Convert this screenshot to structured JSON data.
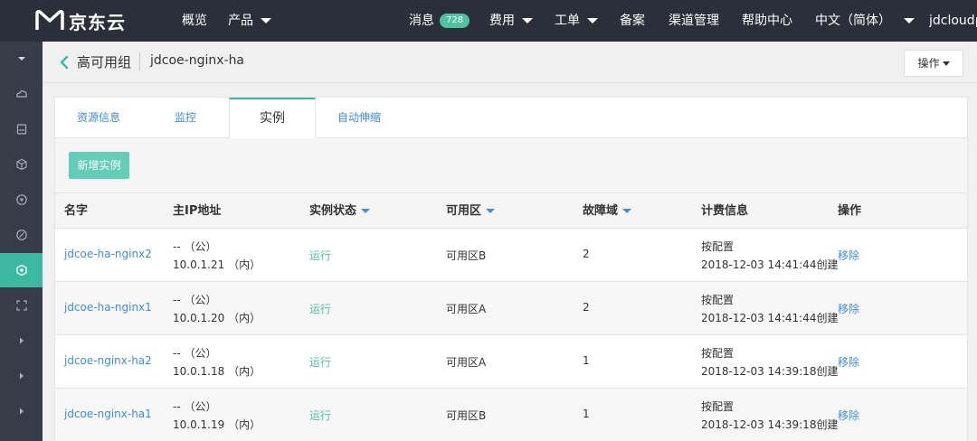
{
  "topbar": {
    "brand": "京东云",
    "nav": [
      {
        "label": "概览",
        "dropdown": false
      },
      {
        "label": "产品",
        "dropdown": true
      }
    ],
    "right": {
      "messages_label": "消息",
      "messages_count": "728",
      "fees_label": "费用",
      "tickets_label": "工单",
      "filing_label": "备案",
      "channel_label": "渠道管理",
      "help_label": "帮助中心",
      "language_label": "中文（简体）",
      "user_label": "jdcloudpr"
    }
  },
  "sidebar": {
    "icons": [
      "chevron-down-icon",
      "cloud-host-icon",
      "database-icon",
      "cube-icon",
      "network-icon",
      "security-icon",
      "ha-group-icon",
      "expand-icon",
      "chevron-right-icon",
      "chevron-right-icon",
      "chevron-right-icon"
    ],
    "active_index": 6
  },
  "breadcrumb": {
    "title": "高可用组",
    "subtitle": "jdcoe-nginx-ha",
    "operate_label": "操作"
  },
  "tabs": [
    {
      "label": "资源信息",
      "active": false
    },
    {
      "label": "监控",
      "active": false
    },
    {
      "label": "实例",
      "active": true
    },
    {
      "label": "自动伸缩",
      "active": false
    }
  ],
  "toolbar": {
    "add_instance_label": "新增实例"
  },
  "table": {
    "headers": {
      "name": "名字",
      "ip": "主IP地址",
      "status": "实例状态",
      "az": "可用区",
      "fault_domain": "故障域",
      "billing": "计费信息",
      "action": "操作"
    },
    "rows": [
      {
        "name": "jdcoe-ha-nginx2",
        "public_ip": "-- （公）",
        "private_ip": "10.0.1.21 （内）",
        "status": "运行",
        "az": "可用区B",
        "fault_domain": "2",
        "billing_type": "按配置",
        "created": "2018-12-03 14:41:44创建",
        "action": "移除"
      },
      {
        "name": "jdcoe-ha-nginx1",
        "public_ip": "-- （公）",
        "private_ip": "10.0.1.20 （内）",
        "status": "运行",
        "az": "可用区A",
        "fault_domain": "2",
        "billing_type": "按配置",
        "created": "2018-12-03 14:41:44创建",
        "action": "移除"
      },
      {
        "name": "jdcoe-nginx-ha2",
        "public_ip": "-- （公）",
        "private_ip": "10.0.1.18 （内）",
        "status": "运行",
        "az": "可用区A",
        "fault_domain": "1",
        "billing_type": "按配置",
        "created": "2018-12-03 14:39:18创建",
        "action": "移除"
      },
      {
        "name": "jdcoe-nginx-ha1",
        "public_ip": "-- （公）",
        "private_ip": "10.0.1.19 （内）",
        "status": "运行",
        "az": "可用区B",
        "fault_domain": "1",
        "billing_type": "按配置",
        "created": "2018-12-03 14:39:18创建",
        "action": "移除"
      }
    ]
  },
  "colors": {
    "topbar_bg": "#2b2f3a",
    "sidebar_bg": "#373c48",
    "accent": "#3db8a0",
    "link": "#3a8ee6"
  }
}
